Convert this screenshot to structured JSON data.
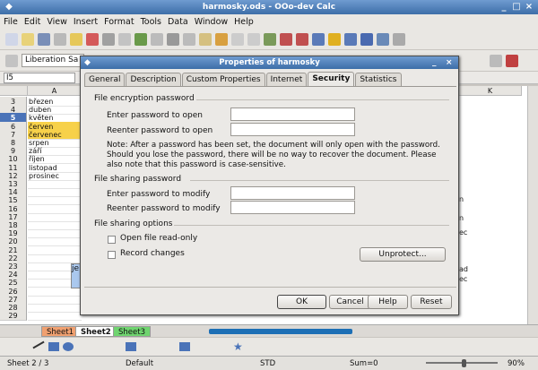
{
  "window": {
    "title": "harmosky.ods - OOo-dev Calc"
  },
  "menu": [
    "File",
    "Edit",
    "View",
    "Insert",
    "Format",
    "Tools",
    "Data",
    "Window",
    "Help"
  ],
  "format_toolbar": {
    "font_name": "Liberation Sa"
  },
  "formula_bar": {
    "cell_ref": "I5"
  },
  "sheet": {
    "column_headers": [
      "A",
      "K"
    ],
    "rows": [
      {
        "num": "3",
        "a": "březen",
        "hl": false
      },
      {
        "num": "4",
        "a": "duben",
        "hl": false
      },
      {
        "num": "5",
        "a": "květen",
        "hl": false
      },
      {
        "num": "6",
        "a": "červen",
        "hl": true
      },
      {
        "num": "7",
        "a": "červenec",
        "hl": true
      },
      {
        "num": "8",
        "a": "srpen",
        "hl": false
      },
      {
        "num": "9",
        "a": "září",
        "hl": false
      },
      {
        "num": "10",
        "a": "říjen",
        "hl": false
      },
      {
        "num": "11",
        "a": "listopad",
        "hl": false
      },
      {
        "num": "12",
        "a": "prosinec",
        "hl": false
      },
      {
        "num": "13",
        "a": "",
        "hl": false
      },
      {
        "num": "14",
        "a": "",
        "hl": false
      },
      {
        "num": "15",
        "a": "",
        "hl": false
      },
      {
        "num": "16",
        "a": "",
        "hl": false
      },
      {
        "num": "17",
        "a": "",
        "hl": false
      },
      {
        "num": "18",
        "a": "",
        "hl": false
      },
      {
        "num": "19",
        "a": "",
        "hl": false
      },
      {
        "num": "20",
        "a": "",
        "hl": false
      },
      {
        "num": "21",
        "a": "",
        "hl": false
      },
      {
        "num": "22",
        "a": "",
        "hl": false
      },
      {
        "num": "23",
        "a": "",
        "hl": false
      },
      {
        "num": "24",
        "a": "",
        "hl": false
      },
      {
        "num": "25",
        "a": "",
        "hl": false
      },
      {
        "num": "26",
        "a": "",
        "hl": false
      },
      {
        "num": "27",
        "a": "",
        "hl": false
      },
      {
        "num": "28",
        "a": "",
        "hl": false
      },
      {
        "num": "29",
        "a": "",
        "hl": false
      }
    ],
    "right_fragments": [
      "n",
      "n",
      "ec",
      "ad",
      "ec"
    ],
    "left_fragment": "je"
  },
  "sheet_tabs": [
    "Sheet1",
    "Sheet2",
    "Sheet3"
  ],
  "status": {
    "sheet": "Sheet 2 / 3",
    "style": "Default",
    "mode": "STD",
    "sum": "Sum=0",
    "zoom": "90%",
    "zoom_level": 0.9
  },
  "dialog": {
    "title": "Properties of harmosky",
    "tabs": [
      "General",
      "Description",
      "Custom Properties",
      "Internet",
      "Security",
      "Statistics"
    ],
    "active_tab": "Security",
    "encrypt_title": "File encryption password",
    "enter_open": "Enter password to open",
    "reenter_open": "Reenter password to open",
    "note": "Note: After a password has been set, the document will only open with the password. Should you lose the password, there will be no way to recover the document. Please also note that this password is case-sensitive.",
    "sharing_title": "File sharing password",
    "enter_modify": "Enter password to modify",
    "reenter_modify": "Reenter password to modify",
    "options_title": "File sharing options",
    "open_readonly": "Open file read-only",
    "record_changes": "Record changes",
    "unprotect": "Unprotect...",
    "ok": "OK",
    "cancel": "Cancel",
    "help": "Help",
    "reset": "Reset"
  },
  "colors": {
    "accent": "#4a73b8",
    "highlight": "#f7d14a",
    "tab1": "#f0a070",
    "tab2": "#ffffff",
    "tab3": "#6fd46f"
  }
}
